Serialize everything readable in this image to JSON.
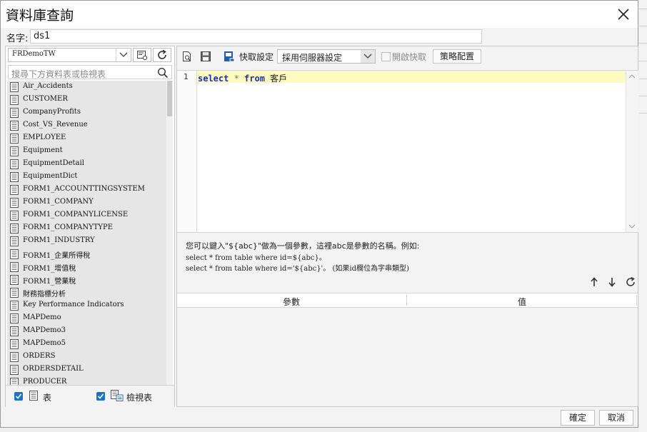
{
  "dialog": {
    "title": "資料庫查詢",
    "name_label": "名字:",
    "name_value": "ds1",
    "ok_label": "確定",
    "cancel_label": "取消"
  },
  "left_panel": {
    "database": "FRDemoTW",
    "search_placeholder": "搜尋下方資料表或檢視表",
    "tables": [
      "Air_Accidents",
      "CUSTOMER",
      "CompanyProfits",
      "Cost_VS_Revenue",
      "EMPLOYEE",
      "Equipment",
      "EquipmentDetail",
      "EquipmentDict",
      "FORM1_ACCOUNTTINGSYSTEM",
      "FORM1_COMPANY",
      "FORM1_COMPANYLICENSE",
      "FORM1_COMPANYTYPE",
      "FORM1_INDUSTRY",
      "FORM1_企業所得稅",
      "FORM1_增值稅",
      "FORM1_營業稅",
      "財務指標分析",
      "Key Performance Indicators",
      "MAPDemo",
      "MAPDemo3",
      "MAPDemo5",
      "ORDERS",
      "ORDERSDETAIL",
      "PRODUCER"
    ],
    "filter_tables_label": "表",
    "filter_views_label": "檢視表"
  },
  "toolbar": {
    "cache_label": "快取設定",
    "cache_option": "採用伺服器設定",
    "enable_cache_label": "開啟快取",
    "strategy_button": "策略配置"
  },
  "editor": {
    "line_number": "1",
    "kw_select": "select",
    "op_star": " * ",
    "kw_from": "from",
    "table": " 客戶"
  },
  "hint": {
    "line1": "您可以鍵入\"${abc}\"做為一個參數，這裡abc是參數的名稱。例如:",
    "line2": "select * from table where id=${abc}。",
    "line3": "select * from table where id='${abc}'。 (如果id欄位為字串類型)"
  },
  "params": {
    "col_param": "參數",
    "col_value": "值"
  }
}
